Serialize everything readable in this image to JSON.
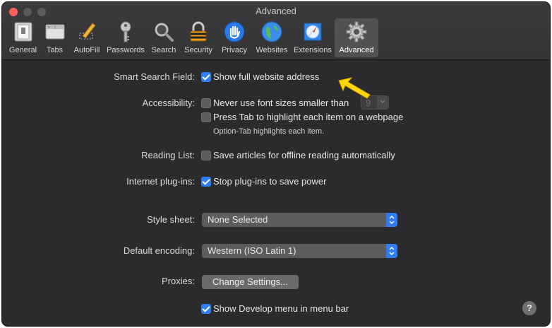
{
  "window": {
    "title": "Advanced"
  },
  "toolbar": {
    "items": [
      {
        "label": "General",
        "icon": "general-switch-icon"
      },
      {
        "label": "Tabs",
        "icon": "tabs-icon"
      },
      {
        "label": "AutoFill",
        "icon": "autofill-pencil-icon"
      },
      {
        "label": "Passwords",
        "icon": "key-icon"
      },
      {
        "label": "Search",
        "icon": "magnifier-icon"
      },
      {
        "label": "Security",
        "icon": "lock-icon"
      },
      {
        "label": "Privacy",
        "icon": "hand-icon"
      },
      {
        "label": "Websites",
        "icon": "globe-icon"
      },
      {
        "label": "Extensions",
        "icon": "puzzle-compass-icon"
      },
      {
        "label": "Advanced",
        "icon": "gear-icon"
      }
    ],
    "selected": "Advanced"
  },
  "settings": {
    "smart_search": {
      "label": "Smart Search Field:",
      "option": "Show full website address",
      "checked": true
    },
    "accessibility": {
      "label": "Accessibility:",
      "option1": "Never use font sizes smaller than",
      "option1_checked": false,
      "font_size": "9",
      "option2": "Press Tab to highlight each item on a webpage",
      "option2_checked": false,
      "hint": "Option-Tab highlights each item."
    },
    "reading_list": {
      "label": "Reading List:",
      "option": "Save articles for offline reading automatically",
      "checked": false
    },
    "plugins": {
      "label": "Internet plug-ins:",
      "option": "Stop plug-ins to save power",
      "checked": true
    },
    "style_sheet": {
      "label": "Style sheet:",
      "value": "None Selected"
    },
    "encoding": {
      "label": "Default encoding:",
      "value": "Western (ISO Latin 1)"
    },
    "proxies": {
      "label": "Proxies:",
      "button": "Change Settings..."
    },
    "develop": {
      "option": "Show Develop menu in menu bar",
      "checked": true
    }
  },
  "help": {
    "symbol": "?"
  },
  "colors": {
    "accent": "#2f7cf6",
    "window_bg": "#2b2b2d",
    "close": "#fc605c",
    "pointer": "#ffd60a"
  }
}
